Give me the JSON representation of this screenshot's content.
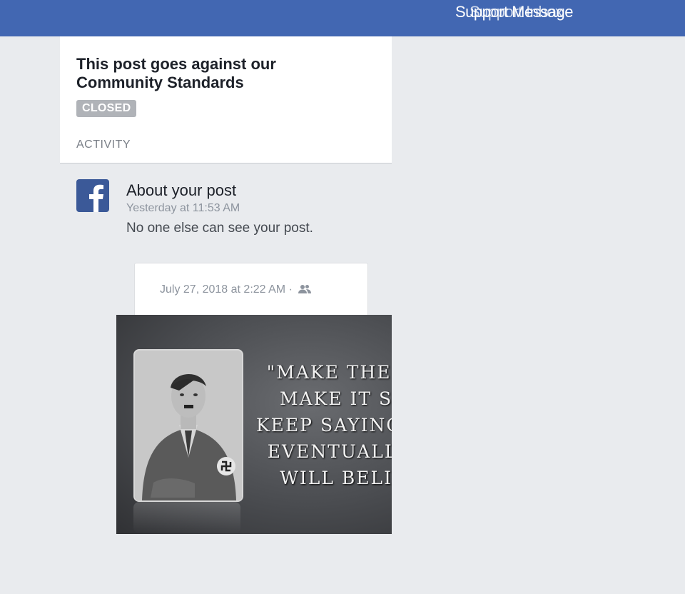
{
  "header": {
    "title": "Support Message",
    "title_ghost": "Support Inbox",
    "bg_color": "#4267b2"
  },
  "status_card": {
    "title": "This post goes against our Community Standards",
    "badge": "CLOSED",
    "section_label": "ACTIVITY"
  },
  "activity": {
    "icon": "facebook-logo-icon",
    "title": "About your post",
    "timestamp": "Yesterday at 11:53 AM",
    "message": "No one else can see your post."
  },
  "post": {
    "date": "July 27, 2018 at 2:22 AM",
    "separator": "·",
    "audience_icon": "friends-icon",
    "image": {
      "quote": "\"MAKE THE\n  MAKE IT S\nKEEP SAYING\n EVENTUALL\n  WILL BELI"
    }
  }
}
